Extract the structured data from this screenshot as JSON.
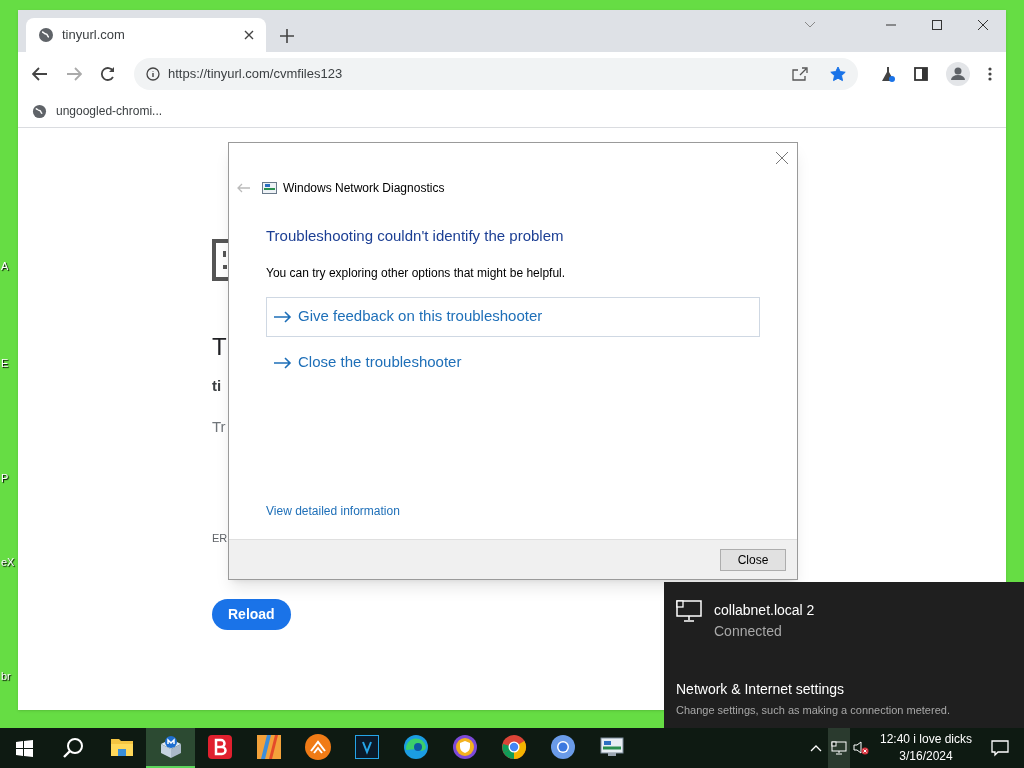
{
  "desktop_labels": [
    "A",
    "E",
    "P",
    "eX",
    "br"
  ],
  "browser": {
    "tab": {
      "title": "tinyurl.com",
      "selected": true
    },
    "url": "https://tinyurl.com/cvmfiles123",
    "bookmarked": true,
    "bookmarks": [
      {
        "label": "ungoogled-chromi..."
      }
    ],
    "error_page": {
      "heading": "T",
      "host": "ti",
      "hint": "Tr",
      "code": "ER",
      "reload": "Reload"
    }
  },
  "dialog": {
    "title": "Windows Network Diagnostics",
    "heading": "Troubleshooting couldn't identify the problem",
    "message": "You can try exploring other options that might be helpful.",
    "options": [
      {
        "label": "Give feedback on this troubleshooter",
        "selected": true
      },
      {
        "label": "Close the troubleshooter",
        "selected": false
      }
    ],
    "details_link": "View detailed information",
    "close_button": "Close"
  },
  "network_flyout": {
    "network_name": "collabnet.local 2",
    "status": "Connected",
    "settings_title": "Network & Internet settings",
    "settings_hint": "Change settings, such as making a connection metered."
  },
  "taskbar": {
    "apps": [
      {
        "kind": "folder",
        "selected": false
      },
      {
        "kind": "boxes",
        "selected": true
      },
      {
        "kind": "b-tile",
        "selected": false
      },
      {
        "kind": "stripes",
        "selected": false
      },
      {
        "kind": "orange-circle",
        "selected": false
      },
      {
        "kind": "v-tile",
        "selected": false
      },
      {
        "kind": "wave",
        "selected": false
      },
      {
        "kind": "shield",
        "selected": false
      },
      {
        "kind": "chrome",
        "selected": false
      },
      {
        "kind": "chromium",
        "selected": false
      },
      {
        "kind": "monitor",
        "selected": false
      }
    ],
    "network_tray_selected": true,
    "volume_muted": true,
    "clock_time": "12:40 i love dicks",
    "clock_date": "3/16/2024"
  }
}
